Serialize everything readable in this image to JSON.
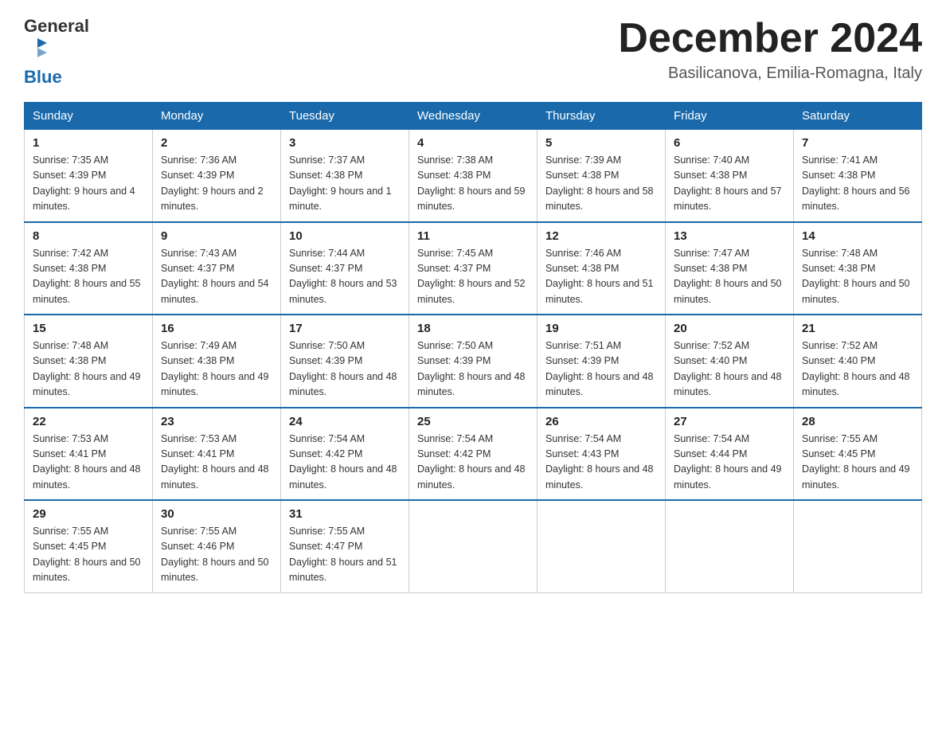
{
  "logo": {
    "text_general": "General",
    "text_blue": "Blue"
  },
  "title": "December 2024",
  "location": "Basilicanova, Emilia-Romagna, Italy",
  "days_of_week": [
    "Sunday",
    "Monday",
    "Tuesday",
    "Wednesday",
    "Thursday",
    "Friday",
    "Saturday"
  ],
  "weeks": [
    [
      {
        "day": "1",
        "sunrise": "7:35 AM",
        "sunset": "4:39 PM",
        "daylight": "9 hours and 4 minutes."
      },
      {
        "day": "2",
        "sunrise": "7:36 AM",
        "sunset": "4:39 PM",
        "daylight": "9 hours and 2 minutes."
      },
      {
        "day": "3",
        "sunrise": "7:37 AM",
        "sunset": "4:38 PM",
        "daylight": "9 hours and 1 minute."
      },
      {
        "day": "4",
        "sunrise": "7:38 AM",
        "sunset": "4:38 PM",
        "daylight": "8 hours and 59 minutes."
      },
      {
        "day": "5",
        "sunrise": "7:39 AM",
        "sunset": "4:38 PM",
        "daylight": "8 hours and 58 minutes."
      },
      {
        "day": "6",
        "sunrise": "7:40 AM",
        "sunset": "4:38 PM",
        "daylight": "8 hours and 57 minutes."
      },
      {
        "day": "7",
        "sunrise": "7:41 AM",
        "sunset": "4:38 PM",
        "daylight": "8 hours and 56 minutes."
      }
    ],
    [
      {
        "day": "8",
        "sunrise": "7:42 AM",
        "sunset": "4:38 PM",
        "daylight": "8 hours and 55 minutes."
      },
      {
        "day": "9",
        "sunrise": "7:43 AM",
        "sunset": "4:37 PM",
        "daylight": "8 hours and 54 minutes."
      },
      {
        "day": "10",
        "sunrise": "7:44 AM",
        "sunset": "4:37 PM",
        "daylight": "8 hours and 53 minutes."
      },
      {
        "day": "11",
        "sunrise": "7:45 AM",
        "sunset": "4:37 PM",
        "daylight": "8 hours and 52 minutes."
      },
      {
        "day": "12",
        "sunrise": "7:46 AM",
        "sunset": "4:38 PM",
        "daylight": "8 hours and 51 minutes."
      },
      {
        "day": "13",
        "sunrise": "7:47 AM",
        "sunset": "4:38 PM",
        "daylight": "8 hours and 50 minutes."
      },
      {
        "day": "14",
        "sunrise": "7:48 AM",
        "sunset": "4:38 PM",
        "daylight": "8 hours and 50 minutes."
      }
    ],
    [
      {
        "day": "15",
        "sunrise": "7:48 AM",
        "sunset": "4:38 PM",
        "daylight": "8 hours and 49 minutes."
      },
      {
        "day": "16",
        "sunrise": "7:49 AM",
        "sunset": "4:38 PM",
        "daylight": "8 hours and 49 minutes."
      },
      {
        "day": "17",
        "sunrise": "7:50 AM",
        "sunset": "4:39 PM",
        "daylight": "8 hours and 48 minutes."
      },
      {
        "day": "18",
        "sunrise": "7:50 AM",
        "sunset": "4:39 PM",
        "daylight": "8 hours and 48 minutes."
      },
      {
        "day": "19",
        "sunrise": "7:51 AM",
        "sunset": "4:39 PM",
        "daylight": "8 hours and 48 minutes."
      },
      {
        "day": "20",
        "sunrise": "7:52 AM",
        "sunset": "4:40 PM",
        "daylight": "8 hours and 48 minutes."
      },
      {
        "day": "21",
        "sunrise": "7:52 AM",
        "sunset": "4:40 PM",
        "daylight": "8 hours and 48 minutes."
      }
    ],
    [
      {
        "day": "22",
        "sunrise": "7:53 AM",
        "sunset": "4:41 PM",
        "daylight": "8 hours and 48 minutes."
      },
      {
        "day": "23",
        "sunrise": "7:53 AM",
        "sunset": "4:41 PM",
        "daylight": "8 hours and 48 minutes."
      },
      {
        "day": "24",
        "sunrise": "7:54 AM",
        "sunset": "4:42 PM",
        "daylight": "8 hours and 48 minutes."
      },
      {
        "day": "25",
        "sunrise": "7:54 AM",
        "sunset": "4:42 PM",
        "daylight": "8 hours and 48 minutes."
      },
      {
        "day": "26",
        "sunrise": "7:54 AM",
        "sunset": "4:43 PM",
        "daylight": "8 hours and 48 minutes."
      },
      {
        "day": "27",
        "sunrise": "7:54 AM",
        "sunset": "4:44 PM",
        "daylight": "8 hours and 49 minutes."
      },
      {
        "day": "28",
        "sunrise": "7:55 AM",
        "sunset": "4:45 PM",
        "daylight": "8 hours and 49 minutes."
      }
    ],
    [
      {
        "day": "29",
        "sunrise": "7:55 AM",
        "sunset": "4:45 PM",
        "daylight": "8 hours and 50 minutes."
      },
      {
        "day": "30",
        "sunrise": "7:55 AM",
        "sunset": "4:46 PM",
        "daylight": "8 hours and 50 minutes."
      },
      {
        "day": "31",
        "sunrise": "7:55 AM",
        "sunset": "4:47 PM",
        "daylight": "8 hours and 51 minutes."
      },
      null,
      null,
      null,
      null
    ]
  ]
}
